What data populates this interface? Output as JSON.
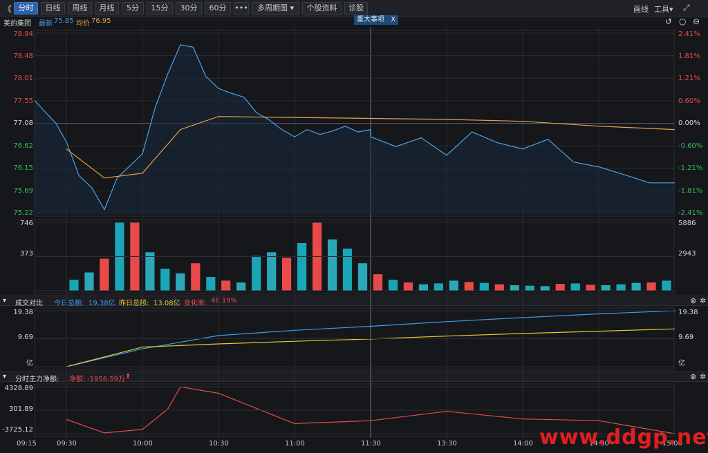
{
  "toolbar": {
    "back_glyph": "《",
    "tabs": [
      {
        "label": "分时",
        "active": true
      },
      {
        "label": "日线"
      },
      {
        "label": "周线"
      },
      {
        "label": "月线"
      },
      {
        "label": "5分"
      },
      {
        "label": "15分"
      },
      {
        "label": "30分"
      },
      {
        "label": "60分"
      }
    ],
    "more_label": "•••",
    "period_label": "多周期图",
    "period_caret": "▾",
    "profile_label": "个股资料",
    "diagnose_label": "诊股",
    "draw_label": "画线",
    "tools_label": "工具",
    "tools_caret": "▾",
    "expand_glyph": "⤢",
    "undo_glyph": "↺",
    "circle_glyph": "○",
    "minus_glyph": "⊖"
  },
  "info": {
    "stock_name": "美的集团",
    "latest_label": "最新",
    "latest_value": "75.85",
    "avg_label": "均价",
    "avg_value": "76.95",
    "news_label": "重大事项",
    "news_close": "X"
  },
  "price_axis": {
    "left": [
      "78.94",
      "78.48",
      "78.01",
      "77.55",
      "77.08",
      "76.62",
      "76.15",
      "75.69",
      "75.22"
    ],
    "right": [
      "2.41%",
      "1.81%",
      "1.21%",
      "0.60%",
      "0.00%",
      "-0.60%",
      "-1.21%",
      "-1.81%",
      "-2.41%"
    ],
    "prev_close": 77.08,
    "min": 75.22,
    "max": 78.94
  },
  "volume_axis": {
    "left_top": "746",
    "left_mid": "373",
    "right_top": "5886",
    "right_mid": "2943"
  },
  "turnover_panel": {
    "collapse_glyph": "▾",
    "title": "成交对比",
    "today_label": "今日总额:",
    "today_value": "19.38亿",
    "yesterday_label": "昨日总额:",
    "yesterday_value": "13.08亿",
    "change_label": "变化率:",
    "change_value": "48.19%",
    "axis_top": "19.38",
    "axis_mid": "9.69",
    "axis_unit": "亿"
  },
  "mainforce_panel": {
    "collapse_glyph": "▾",
    "title": "分时主力净额:",
    "net_label": "净额:",
    "net_value": "-1956.59万",
    "net_arrow": "⬆",
    "axis_top": "4328.89",
    "axis_mid": "301.89",
    "axis_bottom": "-3725.12"
  },
  "time_axis": [
    "09:15",
    "09:30",
    "10:00",
    "10:30",
    "11:00",
    "11:30",
    "13:30",
    "14:00",
    "14:30",
    "15:00"
  ],
  "watermark": "www.ddgp.net",
  "colors": {
    "price_line": "#4aa3e8",
    "avg_line": "#e8a24c",
    "up": "#e84a4a",
    "down": "#2fbf56",
    "flat": "#d9d9d9",
    "vol_down": "#1aa6b7",
    "today_line": "#3e9be8",
    "yesterday_line": "#e6c82f",
    "mainforce_line": "#e84a4a",
    "grid": "#2a2d33"
  },
  "chart_data": [
    {
      "type": "line",
      "title": "",
      "series": [
        {
          "name": "最新",
          "x": [
            "09:15",
            "09:25",
            "09:30",
            "09:35",
            "09:40",
            "09:45",
            "09:50",
            "09:55",
            "10:00",
            "10:05",
            "10:10",
            "10:15",
            "10:20",
            "10:25",
            "10:30",
            "10:35",
            "10:40",
            "10:45",
            "10:50",
            "10:55",
            "11:00",
            "11:05",
            "11:10",
            "11:15",
            "11:20",
            "11:25",
            "11:30",
            "13:00",
            "13:10",
            "13:20",
            "13:30",
            "13:40",
            "13:50",
            "14:00",
            "14:10",
            "14:20",
            "14:30",
            "14:40",
            "14:50",
            "15:00"
          ],
          "values": [
            77.55,
            77.08,
            76.7,
            76.0,
            75.75,
            75.3,
            75.95,
            76.2,
            76.45,
            77.4,
            78.1,
            78.7,
            78.65,
            78.05,
            77.8,
            77.7,
            77.62,
            77.3,
            77.15,
            76.95,
            76.8,
            76.95,
            76.85,
            76.92,
            77.02,
            76.9,
            76.95,
            76.8,
            76.6,
            76.78,
            76.42,
            76.9,
            76.68,
            76.55,
            76.75,
            76.28,
            76.18,
            76.02,
            75.85,
            75.85
          ]
        },
        {
          "name": "均价",
          "x": [
            "09:30",
            "09:45",
            "10:00",
            "10:15",
            "10:30",
            "11:00",
            "11:30",
            "13:30",
            "14:00",
            "14:30",
            "15:00"
          ],
          "values": [
            76.55,
            75.95,
            76.05,
            76.95,
            77.22,
            77.2,
            77.18,
            77.16,
            77.12,
            77.02,
            76.95
          ]
        }
      ],
      "ylim": [
        75.22,
        78.94
      ]
    },
    {
      "type": "bar",
      "title": "",
      "series": [
        {
          "name": "",
          "values": [
            120,
            200,
            350,
            746,
            746,
            420,
            240,
            190,
            300,
            150,
            110,
            90,
            380,
            420,
            360,
            520,
            746,
            560,
            460,
            300,
            180,
            120,
            90,
            70,
            80,
            110,
            95,
            85,
            70,
            60,
            55,
            50,
            75,
            80,
            65,
            60,
            70,
            85,
            90,
            110
          ]
        }
      ],
      "ylim": [
        0,
        746
      ]
    },
    {
      "type": "line",
      "title": "",
      "x": [
        "09:30",
        "10:00",
        "10:30",
        "11:00",
        "11:30",
        "13:30",
        "14:00",
        "14:30",
        "15:00"
      ],
      "series": [
        {
          "name": "今日总额",
          "values": [
            0.0,
            6.2,
            10.8,
            12.6,
            14.0,
            15.6,
            17.0,
            18.3,
            19.38
          ]
        },
        {
          "name": "昨日总额",
          "values": [
            0.0,
            6.8,
            7.9,
            8.8,
            9.6,
            10.6,
            11.5,
            12.3,
            13.08
          ]
        }
      ],
      "ylim": [
        0,
        19.38
      ]
    },
    {
      "type": "line",
      "title": "",
      "x": [
        "09:30",
        "09:45",
        "10:00",
        "10:10",
        "10:15",
        "10:30",
        "11:00",
        "11:30",
        "13:30",
        "14:00",
        "14:30",
        "15:00"
      ],
      "series": [
        {
          "name": "分时主力净额",
          "values": [
            -1300,
            -3600,
            -3000,
            500,
            4300,
            3200,
            -2000,
            -1500,
            100,
            -1200,
            -1500,
            -3725
          ]
        }
      ],
      "ylim": [
        -3725.12,
        4328.89
      ]
    }
  ]
}
